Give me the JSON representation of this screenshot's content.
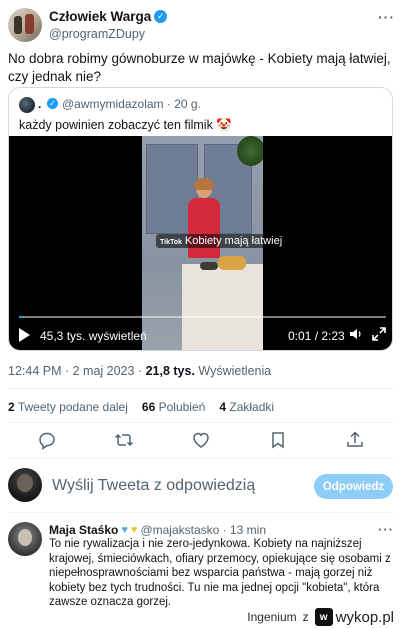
{
  "author": {
    "display_name": "Człowiek Warga",
    "handle": "@programZDupy",
    "verified_badge": "verified-badge"
  },
  "tweet": {
    "text": "No dobra robimy gównoburze w majówkę - Kobiety mają łatwiej, czy jednak nie?"
  },
  "quote": {
    "author_name": ".",
    "handle_time": "@awmymidazolam · 20 g.",
    "text": "każdy powinien zobaczyć ten filmik 🤡",
    "video": {
      "caption": "Kobiety mają łatwiej",
      "overlay_logo": "TikTok",
      "views": "45,3 tys. wyświetleń",
      "time": "0:01 / 2:23",
      "progress": 0.01
    }
  },
  "meta": {
    "timestamp": "12:44 PM · 2 maj 2023 · ",
    "views_count": "21,8 tys.",
    "views_label": " Wyświetlenia"
  },
  "stats": {
    "retweets_count": "2",
    "retweets_label": "Tweety podane dalej",
    "likes_count": "66",
    "likes_label": "Polubień",
    "bookmarks_count": "4",
    "bookmarks_label": "Zakładki"
  },
  "reply_box": {
    "placeholder": "Wyślij Tweeta z odpowiedzią",
    "button_label": "Odpowiedz"
  },
  "comment": {
    "name": "Maja Staśko",
    "handle_time": "@majakstasko · 13 min",
    "text": "To nie rywalizacja i nie zero-jedynkowa. Kobiety na najniższej krajowej, śmieciówkach, ofiary przemocy, opiekujące się osobami z niepełnosprawnościami bez wsparcia państwa - mają gorzej niż kobiety bez tych trudności. Tu nie ma jednej opcji \"kobieta\", która zawsze oznacza gorzej."
  },
  "watermark": {
    "user": "Ingenium",
    "separator": "z",
    "brand": "wykop.pl"
  },
  "colors": {
    "accent": "#1d9bf0",
    "muted_text": "#536471",
    "reply_button": "#8ecdf7"
  }
}
